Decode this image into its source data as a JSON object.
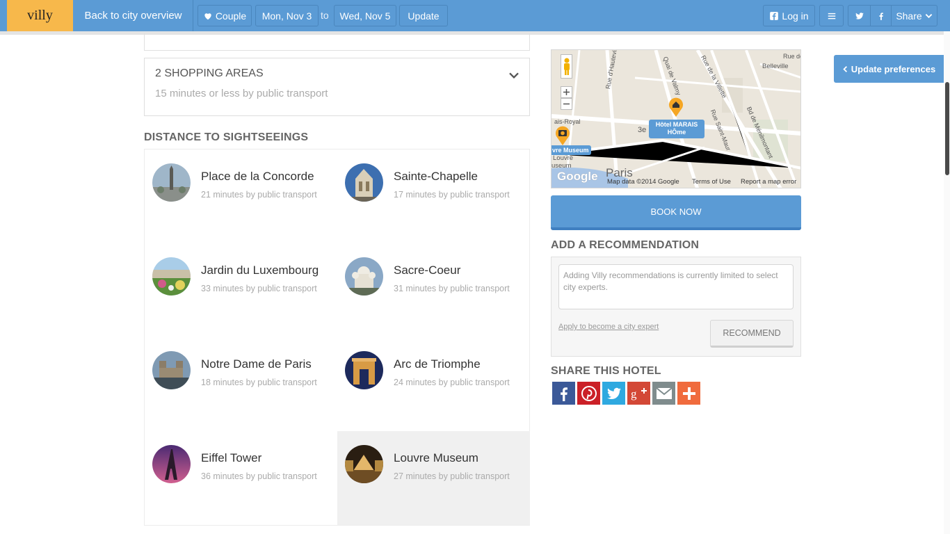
{
  "header": {
    "logo": "villy",
    "back_label": "Back to city overview",
    "traveler_label": "Couple",
    "checkin": "Mon, Nov 3",
    "to_label": "to",
    "checkout": "Wed, Nov 5",
    "update_label": "Update",
    "login_label": "Log in",
    "share_label": "Share"
  },
  "shopping": {
    "title": "2 SHOPPING AREAS",
    "subtitle": "15 minutes or less by public transport"
  },
  "sightseeing": {
    "title": "DISTANCE TO SIGHTSEEINGS",
    "items": [
      {
        "name": "Place de la Concorde",
        "time": "21 minutes by public transport"
      },
      {
        "name": "Sainte-Chapelle",
        "time": "17 minutes by public transport"
      },
      {
        "name": "Jardin du Luxembourg",
        "time": "33 minutes by public transport"
      },
      {
        "name": "Sacre-Coeur",
        "time": "31 minutes by public transport"
      },
      {
        "name": "Notre Dame de Paris",
        "time": "18 minutes by public transport"
      },
      {
        "name": "Arc de Triomphe",
        "time": "24 minutes by public transport"
      },
      {
        "name": "Eiffel Tower",
        "time": "36 minutes by public transport"
      },
      {
        "name": "Louvre Museum",
        "time": "27 minutes by public transport"
      }
    ]
  },
  "map": {
    "hotel_label_line1": "Hôtel MARAIS",
    "hotel_label_line2": "HÔme",
    "museum_label": "vre Museum",
    "museum_sub1": "Louvre",
    "museum_sub2": "useum",
    "city_label": "Paris",
    "district_label": "3e",
    "street_labels": [
      "Rue d'Hauteville",
      "Quai de Valmy",
      "Rue de la Villette",
      "Belleville",
      "Rue de",
      "Rue Saint-Maur",
      "Bd de Ménilmontant",
      "ais-Royal"
    ],
    "footer_data": "Map data ©2014 Google",
    "footer_terms": "Terms of Use",
    "footer_report": "Report a map error",
    "google": "Google"
  },
  "book": {
    "label": "BOOK NOW"
  },
  "recommendation": {
    "title": "ADD A RECOMMENDATION",
    "placeholder": "Adding Villy recommendations is currently limited to select city experts.",
    "apply_link": "Apply to become a city expert",
    "button_label": "RECOMMEND"
  },
  "share": {
    "title": "SHARE THIS HOTEL",
    "colors": {
      "facebook": "#3b5998",
      "pinterest": "#cb2027",
      "twitter": "#2fa9e0",
      "googleplus": "#d34836",
      "email": "#7f8c8d",
      "more": "#f06b3d"
    }
  },
  "side": {
    "update_preferences": "Update preferences"
  }
}
